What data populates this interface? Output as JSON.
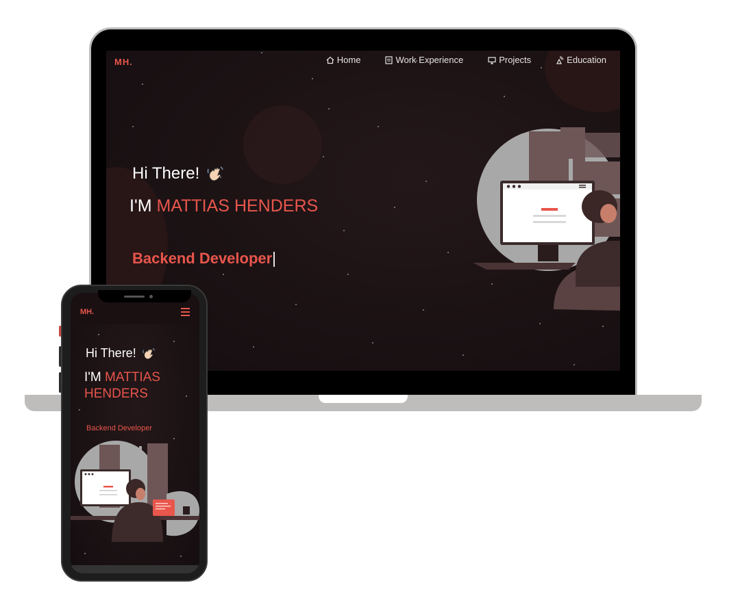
{
  "site": {
    "logo": "MH.",
    "nav": [
      {
        "label": "Home",
        "icon": "home-icon"
      },
      {
        "label": "Work Experience",
        "icon": "document-icon"
      },
      {
        "label": "Projects",
        "icon": "monitor-icon"
      },
      {
        "label": "Education",
        "icon": "antenna-icon"
      }
    ],
    "greeting": "Hi There!",
    "name_prefix": "I'M",
    "name_first": "MATTIAS",
    "name_last": "HENDERS",
    "role": "Backend Developer"
  },
  "colors": {
    "accent": "#e8564c",
    "background": "#1b1214",
    "text": "#ffffff"
  }
}
